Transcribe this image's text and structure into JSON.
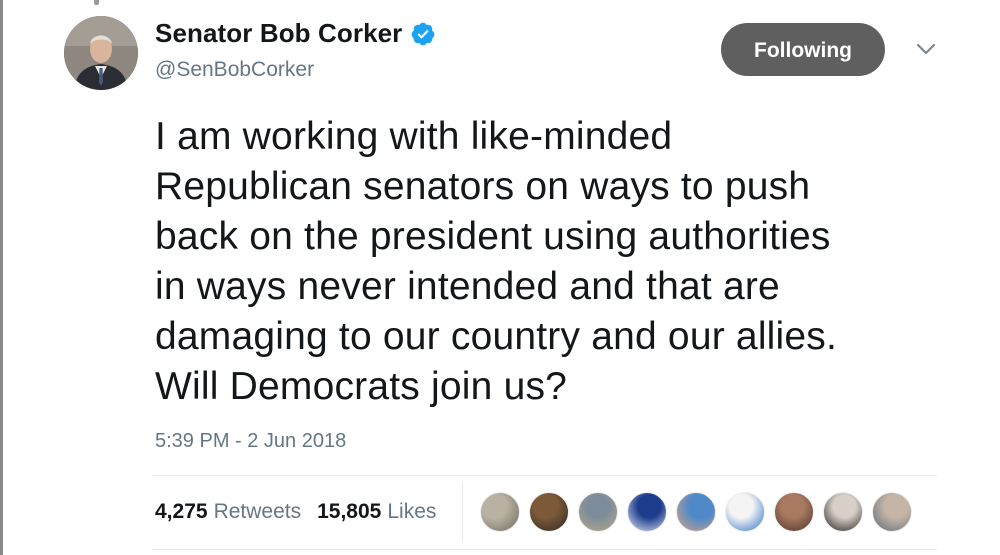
{
  "tweet": {
    "author": {
      "display_name": "Senator Bob Corker",
      "handle": "@SenBobCorker",
      "verified": true,
      "verified_color": "#1da1f2"
    },
    "follow_button": {
      "label": "Following",
      "color": "#5f5f5f"
    },
    "text": "I am working with like-minded\nRepublican senators on ways to push\nback on the president using authorities\nin ways never intended and that are\ndamaging to our country and our allies.\nWill Democrats join us?",
    "timestamp": "5:39 PM - 2 Jun 2018",
    "stats": {
      "retweets": {
        "count": "4,275",
        "label": "Retweets"
      },
      "likes": {
        "count": "15,805",
        "label": "Likes"
      }
    },
    "liker_avatars": [
      {
        "name": "liker-avatar-dog",
        "colors": [
          "#b9b2a3",
          "#6f6a5e"
        ]
      },
      {
        "name": "liker-avatar-man-dark",
        "colors": [
          "#7d5a3a",
          "#2c2620"
        ]
      },
      {
        "name": "liker-avatar-landscape",
        "colors": [
          "#7d8c9a",
          "#b8a68a"
        ]
      },
      {
        "name": "liker-avatar-blue-logo",
        "colors": [
          "#1d3c8c",
          "#e9eef8"
        ]
      },
      {
        "name": "liker-avatar-man-blue",
        "colors": [
          "#4f89c9",
          "#d9a483"
        ]
      },
      {
        "name": "liker-avatar-blue-figure",
        "colors": [
          "#f4f4f4",
          "#2a6fc7"
        ]
      },
      {
        "name": "liker-avatar-woman",
        "colors": [
          "#a97a61",
          "#4a3328"
        ]
      },
      {
        "name": "liker-avatar-woman-dark-hair",
        "colors": [
          "#d8d0c8",
          "#1f1a18"
        ]
      },
      {
        "name": "liker-avatar-man-older",
        "colors": [
          "#c4b5a6",
          "#5a6878"
        ]
      }
    ]
  }
}
